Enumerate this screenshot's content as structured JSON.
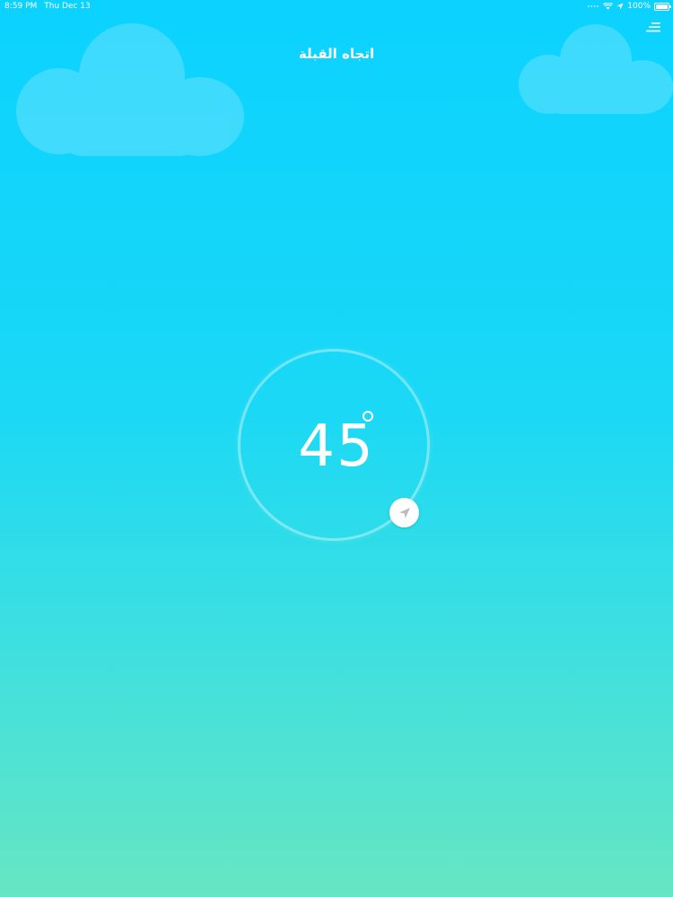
{
  "status_bar": {
    "time": "8:59 PM",
    "date": "Thu Dec 13",
    "battery_text": "100%",
    "battery_level": 1.0
  },
  "header": {
    "title": "اتجاه القبلة",
    "menu_icon": "menu-icon"
  },
  "compass": {
    "degrees": "45",
    "direction_icon": "location-arrow-icon"
  },
  "colors": {
    "background_top": "#0bd2ff",
    "background_bottom": "#66e6c2",
    "text": "#ffffff"
  }
}
